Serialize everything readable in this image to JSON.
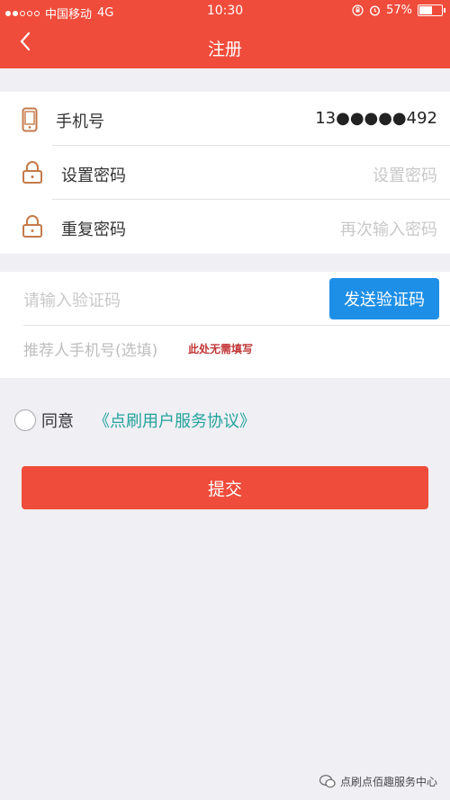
{
  "status_bar": {
    "carrier": "中国移动",
    "network": "4G",
    "time": "10:30",
    "battery_percent": "57%",
    "battery_level": 0.57
  },
  "nav": {
    "back_icon": "chevron-left-icon",
    "title": "注册"
  },
  "form": {
    "phone": {
      "icon": "phone-icon",
      "label": "手机号",
      "value": "13●●●●●492"
    },
    "password": {
      "icon": "lock-icon",
      "label": "设置密码",
      "placeholder": "设置密码"
    },
    "repeat_password": {
      "icon": "lock-icon",
      "label": "重复密码",
      "placeholder": "再次输入密码"
    }
  },
  "verify": {
    "code_placeholder": "请输入验证码",
    "send_button": "发送验证码",
    "referrer_placeholder": "推荐人手机号(选填)",
    "referrer_note": "此处无需填写"
  },
  "agreement": {
    "agree_label": "同意",
    "agreement_link": "《点刷用户服务协议》"
  },
  "submit_label": "提交",
  "watermark": "点刷点佰趣服务中心",
  "colors": {
    "brand_red": "#f04c3b",
    "button_blue": "#1e8fe6",
    "link_teal": "#24a39c",
    "note_red": "#c23636"
  }
}
